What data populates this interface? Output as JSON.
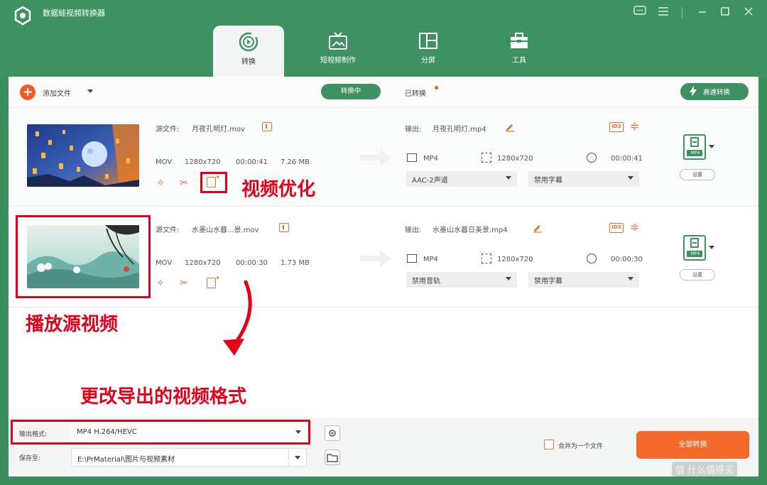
{
  "app": {
    "title": "数据蛙视频转换器"
  },
  "tabs": [
    {
      "label": "转换"
    },
    {
      "label": "短视频制作"
    },
    {
      "label": "分屏"
    },
    {
      "label": "工具"
    }
  ],
  "toolbar": {
    "add_file": "添加文件",
    "converting": "转换中",
    "converted": "已转换",
    "fast_convert": "高速转换"
  },
  "files": [
    {
      "src_label": "源文件:",
      "src_name": "月夜孔明灯.mov",
      "format": "MOV",
      "resolution": "1280x720",
      "duration": "00:00:41",
      "size": "7.26 MB",
      "out_label": "输出:",
      "out_name": "月夜孔明灯.mp4",
      "out_format": "MP4",
      "out_resolution": "1280x720",
      "out_duration": "00:00:41",
      "audio": "AAC-2声道",
      "subtitle": "禁用字幕",
      "badge": "MP4",
      "settings": "设置"
    },
    {
      "src_label": "源文件:",
      "src_name": "水墨山水暮...景.mov",
      "format": "MOV",
      "resolution": "1280x720",
      "duration": "00:00:30",
      "size": "1.73 MB",
      "out_label": "输出:",
      "out_name": "水墨山水暮日美景.mp4",
      "out_format": "MP4",
      "out_resolution": "1280x720",
      "out_duration": "00:00:30",
      "audio": "禁用音轨",
      "subtitle": "禁用字幕",
      "badge": "MP4",
      "settings": "设置"
    }
  ],
  "annotations": {
    "optimize": "视频优化",
    "play_source": "播放源视频",
    "change_format": "更改导出的视频格式"
  },
  "footer": {
    "output_format_label": "输出格式:",
    "output_format_value": "MP4 H.264/HEVC",
    "save_to_label": "保存至:",
    "save_to_value": "E:\\PrMaterial\\图片与视频素材",
    "merge_label": "合并为一个文件",
    "convert_all": "全部转换"
  },
  "watermark": "值 什么值得买",
  "colors": {
    "brand_green": "#3e9160",
    "accent_orange": "#f05a24",
    "annotation_red": "#e3001b"
  }
}
